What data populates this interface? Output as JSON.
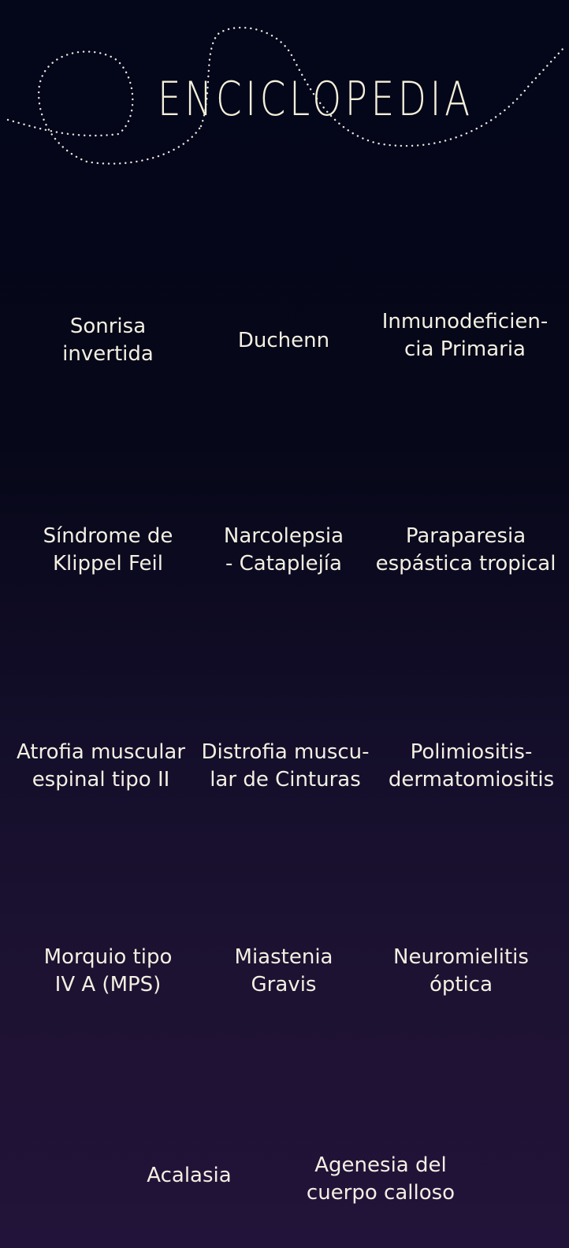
{
  "header": {
    "title": "ENCICLOPEDIA"
  },
  "colors": {
    "background_top": "#04061a",
    "background_bottom": "#22133a",
    "text": "#f3efe2",
    "dotted_orbit": "#e9e6dc"
  },
  "topics": [
    {
      "label": "Sonrisa\ninvertida"
    },
    {
      "label": "Duchenn"
    },
    {
      "label": "Inmunodeficien-\ncia Primaria"
    },
    {
      "label": "Síndrome de\nKlippel Feil"
    },
    {
      "label": "Narcolepsia\n- Cataplejía"
    },
    {
      "label": "Paraparesia\nespástica tropical"
    },
    {
      "label": "Atrofia muscular\nespinal tipo II"
    },
    {
      "label": "Distrofia muscu-\nlar de Cinturas"
    },
    {
      "label": "Polimiositis-\ndermatomiositis"
    },
    {
      "label": "Morquio tipo\nIV A (MPS)"
    },
    {
      "label": "Miastenia\nGravis"
    },
    {
      "label": "Neuromielitis\nóptica"
    },
    {
      "label": "Acalasia"
    },
    {
      "label": "Agenesia del\ncuerpo calloso"
    }
  ]
}
